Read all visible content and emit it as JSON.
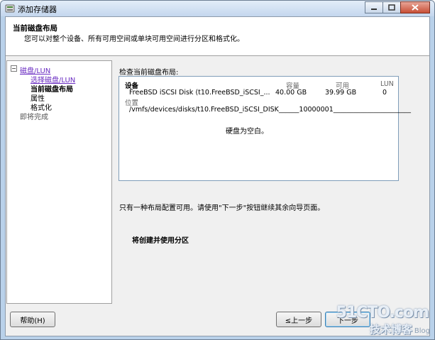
{
  "window": {
    "title": "添加存储器",
    "min_icon": "minimize-icon",
    "max_icon": "maximize-icon",
    "close_icon": "close-icon"
  },
  "header": {
    "title": "当前磁盘布局",
    "description": "您可以对整个设备、所有可用空间或单块可用空间进行分区和格式化。"
  },
  "nav": {
    "items": [
      {
        "label": "磁盘/LUN",
        "style": "link"
      },
      {
        "label": "选择磁盘/LUN",
        "style": "link"
      },
      {
        "label": "当前磁盘布局",
        "style": "bold"
      },
      {
        "label": "属性",
        "style": "normal"
      },
      {
        "label": "格式化",
        "style": "normal"
      },
      {
        "label": "即将完成",
        "style": "gray"
      }
    ]
  },
  "main": {
    "section_label": "检查当前磁盘布局:",
    "columns": {
      "device": "设备",
      "capacity": "容量",
      "available": "可用",
      "lun": "LUN",
      "location": "位置"
    },
    "row": {
      "device": "FreeBSD iSCSI Disk (t10.FreeBSD_iSCSI_...",
      "capacity": "40.00 GB",
      "available": "39.99 GB",
      "lun": "0",
      "location": "/vmfs/devices/disks/t10.FreeBSD_iSCSI_DISK______10000001_______________________"
    },
    "empty_message": "硬盘为空白。",
    "single_layout_message": "只有一种布局配置可用。请使用\"下一步\"按钮继续其余向导页面。",
    "create_message": "将创建并使用分区"
  },
  "footer": {
    "help": "帮助(H)",
    "back": "≤上一步",
    "next": "下一步"
  },
  "watermark": {
    "top": "51CTO.com",
    "bottom": "技术博客",
    "blog": "Blog"
  }
}
